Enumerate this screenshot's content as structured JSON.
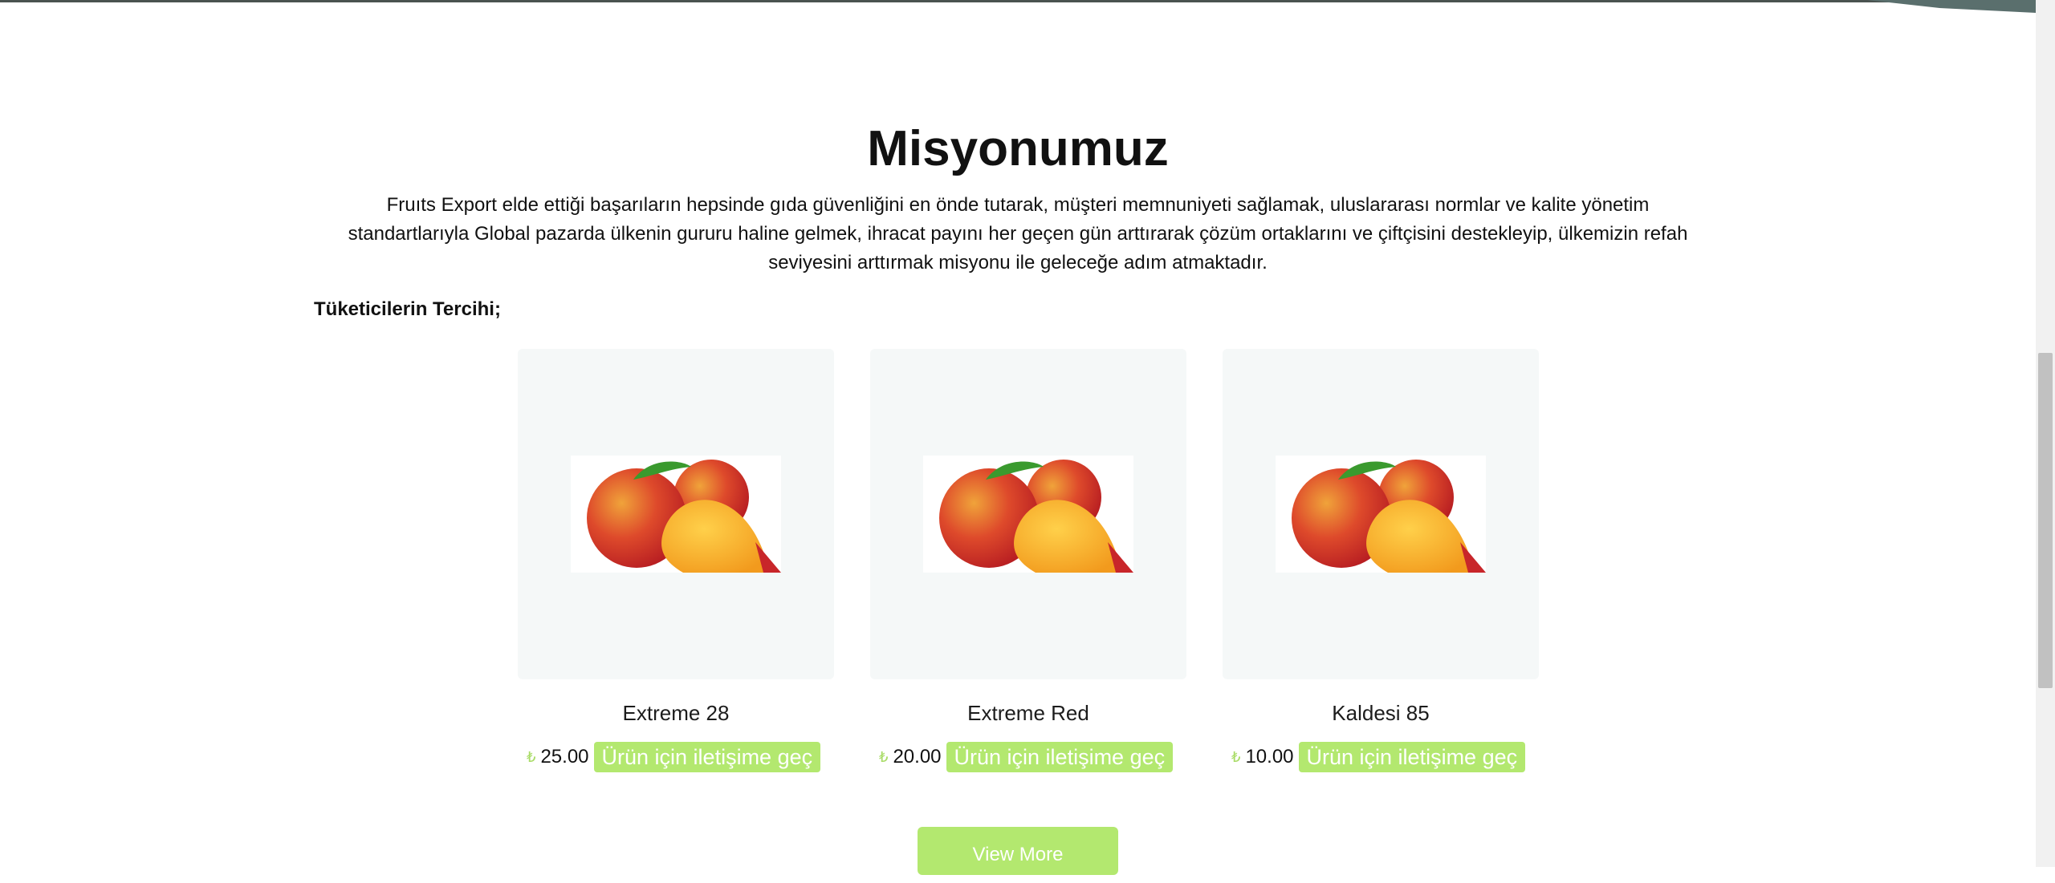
{
  "mission": {
    "title": "Misyonumuz",
    "text": "Fruıts Export elde ettiği başarıların hepsinde gıda güvenliğini en önde tutarak, müşteri memnuniyeti sağlamak, uluslararası normlar ve kalite yönetim standartlarıyla Global pazarda ülkenin gururu haline gelmek, ihracat payını her geçen gün arttırarak çözüm ortaklarını ve çiftçisini destekleyip, ülkemizin refah seviyesini arttırmak misyonu ile geleceğe adım atmaktadır."
  },
  "products_section": {
    "heading": "Tüketicilerin Tercihi;",
    "products": [
      {
        "name": "Extreme 28",
        "currency": "₺",
        "price": "25.00",
        "button_label": "Ürün için iletişime geç",
        "image_icon": "peach-image"
      },
      {
        "name": "Extreme Red",
        "currency": "₺",
        "price": "20.00",
        "button_label": "Ürün için iletişime geç",
        "image_icon": "peach-image"
      },
      {
        "name": "Kaldesi 85",
        "currency": "₺",
        "price": "10.00",
        "button_label": "Ürün için iletişime geç",
        "image_icon": "peach-image"
      }
    ],
    "view_more_label": "View More"
  },
  "colors": {
    "accent_green": "#b3e86f",
    "card_background": "#f5f8f8",
    "text": "#111111"
  }
}
